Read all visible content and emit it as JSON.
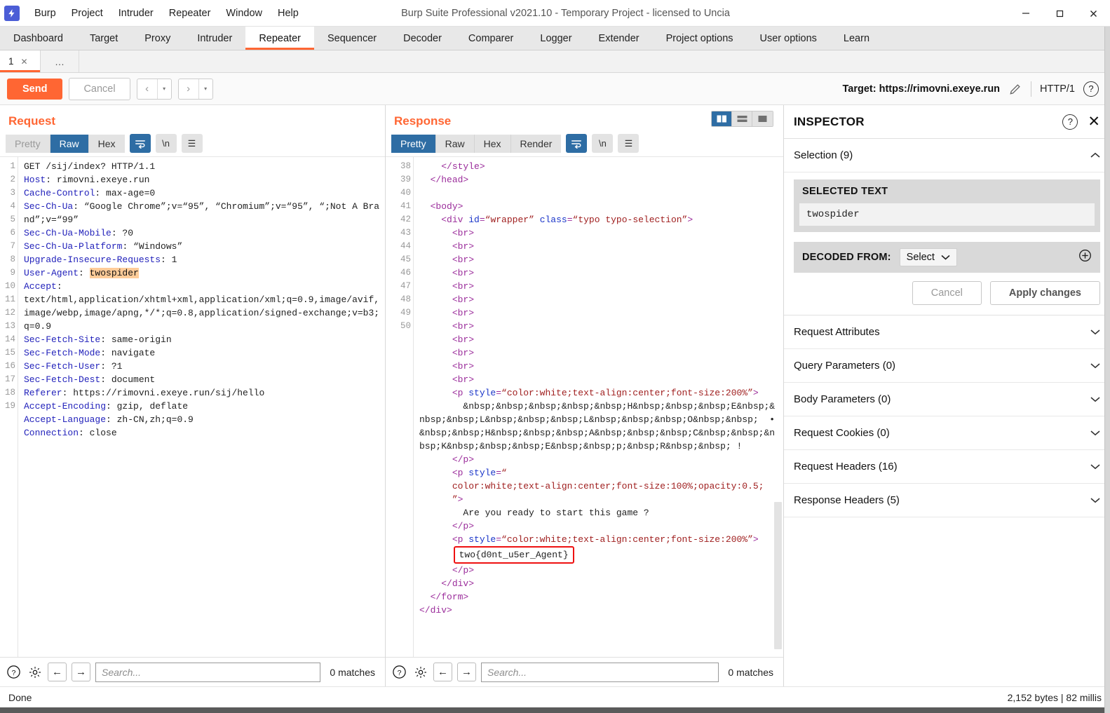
{
  "window": {
    "title": "Burp Suite Professional v2021.10 - Temporary Project - licensed to Uncia",
    "logo_glyph": "⚡",
    "minimize": "—",
    "maximize": "☐",
    "close": "✕"
  },
  "menu": [
    "Burp",
    "Project",
    "Intruder",
    "Repeater",
    "Window",
    "Help"
  ],
  "main_tabs": [
    {
      "label": "Dashboard",
      "active": false
    },
    {
      "label": "Target",
      "active": false
    },
    {
      "label": "Proxy",
      "active": false
    },
    {
      "label": "Intruder",
      "active": false
    },
    {
      "label": "Repeater",
      "active": true
    },
    {
      "label": "Sequencer",
      "active": false
    },
    {
      "label": "Decoder",
      "active": false
    },
    {
      "label": "Comparer",
      "active": false
    },
    {
      "label": "Logger",
      "active": false
    },
    {
      "label": "Extender",
      "active": false
    },
    {
      "label": "Project options",
      "active": false
    },
    {
      "label": "User options",
      "active": false
    },
    {
      "label": "Learn",
      "active": false
    }
  ],
  "sub_tabs": {
    "tab_label": "1",
    "close_glyph": "✕",
    "add_label": "…"
  },
  "action_bar": {
    "send_label": "Send",
    "cancel_label": "Cancel",
    "back_glyph": "‹",
    "forward_glyph": "›",
    "dropdown_glyph": "▾",
    "target_label": "Target: https://rimovni.exeye.run",
    "http_version": "HTTP/1",
    "help_glyph": "?"
  },
  "request": {
    "panel_title": "Request",
    "tabs": [
      {
        "label": "Pretty",
        "active": false,
        "dim": true
      },
      {
        "label": "Raw",
        "active": true,
        "dim": false
      },
      {
        "label": "Hex",
        "active": false,
        "dim": false
      }
    ],
    "wrap_icon": "wrap-lines-icon",
    "newline_label": "\\n",
    "menu_glyph": "☰",
    "lines": [
      {
        "n": "1",
        "text": "GET /sij/index? HTTP/1.1"
      },
      {
        "n": "2",
        "key": "Host",
        "text": ": rimovni.exeye.run"
      },
      {
        "n": "3",
        "key": "Cache-Control",
        "text": ": max-age=0"
      },
      {
        "n": "4",
        "key": "Sec-Ch-Ua",
        "text": ": “Google Chrome”;v=“95”, “Chromium”;v=“95”, “;Not A Brand”;v=“99”"
      },
      {
        "n": "5",
        "key": "Sec-Ch-Ua-Mobile",
        "text": ": ?0"
      },
      {
        "n": "6",
        "key": "Sec-Ch-Ua-Platform",
        "text": ": “Windows”"
      },
      {
        "n": "7",
        "key": "Upgrade-Insecure-Requests",
        "text": ": 1"
      },
      {
        "n": "8",
        "key": "User-Agent",
        "text": ": ",
        "highlight": "twospider"
      },
      {
        "n": "9",
        "key": "Accept",
        "text": ":\ntext/html,application/xhtml+xml,application/xml;q=0.9,image/avif,image/webp,image/apng,*/*;q=0.8,application/signed-exchange;v=b3;q=0.9"
      },
      {
        "n": "10",
        "key": "Sec-Fetch-Site",
        "text": ": same-origin"
      },
      {
        "n": "11",
        "key": "Sec-Fetch-Mode",
        "text": ": navigate"
      },
      {
        "n": "12",
        "key": "Sec-Fetch-User",
        "text": ": ?1"
      },
      {
        "n": "13",
        "key": "Sec-Fetch-Dest",
        "text": ": document"
      },
      {
        "n": "14",
        "key": "Referer",
        "text": ": https://rimovni.exeye.run/sij/hello"
      },
      {
        "n": "15",
        "key": "Accept-Encoding",
        "text": ": gzip, deflate"
      },
      {
        "n": "16",
        "key": "Accept-Language",
        "text": ": zh-CN,zh;q=0.9"
      },
      {
        "n": "17",
        "key": "Connection",
        "text": ": close"
      },
      {
        "n": "18",
        "text": ""
      },
      {
        "n": "19",
        "text": ""
      }
    ],
    "search_placeholder": "Search...",
    "matches": "0 matches",
    "help_glyph": "?",
    "gear_glyph": "⚙",
    "prev_glyph": "←",
    "next_glyph": "→"
  },
  "response": {
    "panel_title": "Response",
    "tabs": [
      {
        "label": "Pretty",
        "active": true,
        "dim": false
      },
      {
        "label": "Raw",
        "active": false,
        "dim": false
      },
      {
        "label": "Hex",
        "active": false,
        "dim": false
      },
      {
        "label": "Render",
        "active": false,
        "dim": false
      }
    ],
    "newline_label": "\\n",
    "menu_glyph": "☰",
    "view_modes": [
      {
        "name": "split-vertical-view",
        "active": true
      },
      {
        "name": "split-horizontal-view",
        "active": false
      },
      {
        "name": "single-view",
        "active": false
      }
    ],
    "code_lines": [
      {
        "n": "38",
        "indent": 3,
        "type": "tag",
        "text": "</style>"
      },
      {
        "n": "39",
        "indent": 2,
        "type": "tag",
        "text": "</head>"
      },
      {
        "n": "40",
        "indent": 0,
        "type": "plain",
        "text": ""
      },
      {
        "n": "41",
        "indent": 2,
        "type": "tag",
        "text": "<body>"
      },
      {
        "n": "42",
        "indent": 3,
        "type": "divtag",
        "tag": "div",
        "attrs": " id=“wrapper” class=“typo typo-selection”"
      },
      {
        "n": "43",
        "indent": 4,
        "type": "tag",
        "text": "<br>"
      },
      {
        "n": "",
        "indent": 4,
        "type": "tag",
        "text": "<br>"
      },
      {
        "n": "",
        "indent": 4,
        "type": "tag",
        "text": "<br>"
      },
      {
        "n": "",
        "indent": 4,
        "type": "tag",
        "text": "<br>"
      },
      {
        "n": "",
        "indent": 4,
        "type": "tag",
        "text": "<br>"
      },
      {
        "n": "",
        "indent": 4,
        "type": "tag",
        "text": "<br>"
      },
      {
        "n": "",
        "indent": 4,
        "type": "tag",
        "text": "<br>"
      },
      {
        "n": "",
        "indent": 4,
        "type": "tag",
        "text": "<br>"
      },
      {
        "n": "",
        "indent": 4,
        "type": "tag",
        "text": "<br>"
      },
      {
        "n": "",
        "indent": 4,
        "type": "tag",
        "text": "<br>"
      },
      {
        "n": "",
        "indent": 4,
        "type": "tag",
        "text": "<br>"
      },
      {
        "n": "",
        "indent": 4,
        "type": "tag",
        "text": "<br>"
      },
      {
        "n": "",
        "indent": 4,
        "type": "tag",
        "text": "<br>"
      }
    ],
    "line44_num": "44",
    "line44_tag_open": "<p style=",
    "line44_style": "“color:white;text-align:center;font-size:200%”",
    "line44_tag_close": ">",
    "line44_body": "&nbsp;&nbsp;&nbsp;&nbsp;&nbsp;H&nbsp;&nbsp;&nbsp;E&nbsp;&nbsp;&nbsp;L&nbsp;&nbsp;&nbsp;L&nbsp;&nbsp;&nbsp;O&nbsp;&nbsp;  • &nbsp;&nbsp;H&nbsp;&nbsp;&nbsp;A&nbsp;&nbsp;&nbsp;C&nbsp;&nbsp;&nbsp;K&nbsp;&nbsp;&nbsp;E&nbsp;&nbsp;&nbsp;R&nbsp;&nbsp; !",
    "line44_end": "</p>",
    "line45_num": "45",
    "line45_tag_open": "<p style=“",
    "line45_style": "color:white;text-align:center;font-size:100%;opacity:0.5;",
    "line45_tag_close": "”>",
    "line45_body": "Are you ready to start this game ?",
    "line45_end": "</p>",
    "line46_num": "46",
    "line46_tag_open": "<p style=",
    "line46_style": "“color:white;text-align:center;font-size:200%”",
    "line46_tag_close": ">",
    "line46_flag": "two{d0nt_u5er_Agent}",
    "line46_end": "</p>",
    "line47_num": "47",
    "line47_text": "</div>",
    "line48_num": "48",
    "line48_text": "</form>",
    "line49_num": "49",
    "line49_text": "</div>",
    "line50_num": "50",
    "search_placeholder": "Search...",
    "matches": "0 matches",
    "help_glyph": "?",
    "gear_glyph": "⚙",
    "prev_glyph": "←",
    "next_glyph": "→"
  },
  "inspector": {
    "title": "INSPECTOR",
    "help_glyph": "?",
    "close_glyph": "✕",
    "selection_label": "Selection (9)",
    "selection_chevron": "⌃",
    "selected_text_label": "SELECTED TEXT",
    "selected_text_value": "twospider",
    "decoded_from_label": "DECODED FROM:",
    "decoded_select_value": "Select",
    "decoded_select_chevron": "⌄",
    "add_glyph": "⊕",
    "cancel_label": "Cancel",
    "apply_label": "Apply changes",
    "sections": [
      {
        "label": "Request Attributes",
        "chevron": "⌄"
      },
      {
        "label": "Query Parameters (0)",
        "chevron": "⌄"
      },
      {
        "label": "Body Parameters (0)",
        "chevron": "⌄"
      },
      {
        "label": "Request Cookies (0)",
        "chevron": "⌄"
      },
      {
        "label": "Request Headers (16)",
        "chevron": "⌄"
      },
      {
        "label": "Response Headers (5)",
        "chevron": "⌄"
      }
    ]
  },
  "status_bar": {
    "left": "Done",
    "right": "2,152 bytes | 82 millis"
  },
  "colors": {
    "accent_orange": "#ff6633",
    "selected_blue": "#2e6da4",
    "flag_red": "#ee1111",
    "highlight_orange": "#ffcc99"
  }
}
